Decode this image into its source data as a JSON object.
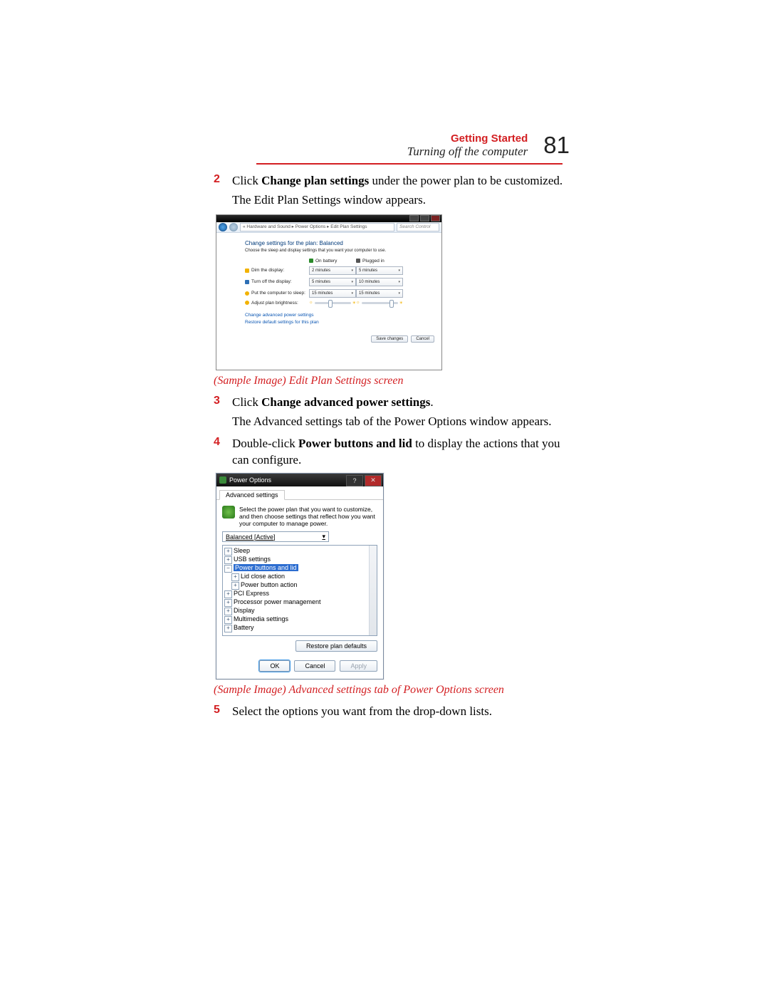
{
  "header": {
    "section": "Getting Started",
    "subtitle": "Turning off the computer",
    "page_number": "81"
  },
  "steps": {
    "s2": {
      "num": "2",
      "pre": "Click ",
      "bold": "Change plan settings",
      "post": " under the power plan to be customized.",
      "cont": "The Edit Plan Settings window appears."
    },
    "caption1": "(Sample Image) Edit Plan Settings screen",
    "s3": {
      "num": "3",
      "pre": "Click ",
      "bold": "Change advanced power settings",
      "post": ".",
      "cont": "The Advanced settings tab of the Power Options window appears."
    },
    "s4": {
      "num": "4",
      "pre": "Double-click ",
      "bold": "Power buttons and lid",
      "post": " to display the actions that you can configure."
    },
    "caption2": "(Sample Image) Advanced settings tab of Power Options screen",
    "s5": {
      "num": "5",
      "text": "Select the options you want from the drop-down lists."
    }
  },
  "win1": {
    "breadcrumb": "« Hardware and Sound ▸ Power Options ▸ Edit Plan Settings",
    "search_placeholder": "Search Control Panel",
    "title": "Change settings for the plan: Balanced",
    "subtitle": "Choose the sleep and display settings that you want your computer to use.",
    "col_battery": "On battery",
    "col_plugged": "Plugged in",
    "rows": {
      "dim": {
        "label": "Dim the display:",
        "bat": "2 minutes",
        "ac": "5 minutes"
      },
      "off": {
        "label": "Turn off the display:",
        "bat": "5 minutes",
        "ac": "10 minutes"
      },
      "sleep": {
        "label": "Put the computer to sleep:",
        "bat": "15 minutes",
        "ac": "15 minutes"
      },
      "bright": {
        "label": "Adjust plan brightness:"
      }
    },
    "link_adv": "Change advanced power settings",
    "link_restore": "Restore default settings for this plan",
    "btn_save": "Save changes",
    "btn_cancel": "Cancel"
  },
  "win2": {
    "title": "Power Options",
    "tab": "Advanced settings",
    "desc": "Select the power plan that you want to customize, and then choose settings that reflect how you want your computer to manage power.",
    "plan_select": "Balanced [Active]",
    "tree": {
      "sleep": "Sleep",
      "usb": "USB settings",
      "pbl": "Power buttons and lid",
      "pbl_children": {
        "lid": "Lid close action",
        "pwr": "Power button action"
      },
      "pci": "PCI Express",
      "proc": "Processor power management",
      "display": "Display",
      "mm": "Multimedia settings",
      "battery": "Battery"
    },
    "restore_btn": "Restore plan defaults",
    "ok": "OK",
    "cancel": "Cancel",
    "apply": "Apply"
  }
}
